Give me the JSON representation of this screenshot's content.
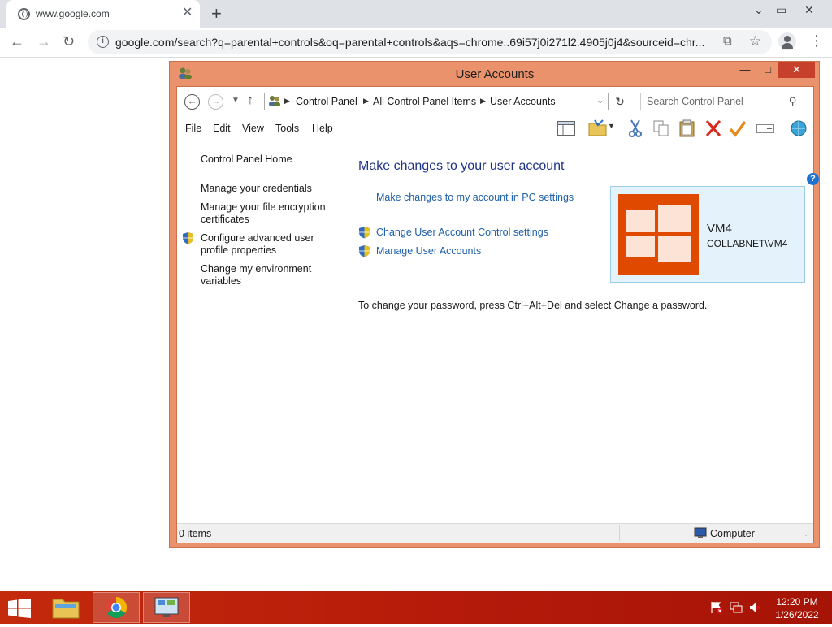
{
  "browser": {
    "tab_title": "www.google.com",
    "tab_close": "✕",
    "new_tab": "+",
    "url": "google.com/search?q=parental+controls&oq=parental+controls&aqs=chrome..69i57j0i271l2.4905j0j4&sourceid=chr...",
    "icons": [
      "globe-icon",
      "back-icon",
      "forward-icon",
      "reload-icon",
      "info-icon",
      "share-icon",
      "star-icon",
      "profile-icon",
      "menu-icon"
    ]
  },
  "window": {
    "title": "User Accounts",
    "address": {
      "crumbs": [
        "Control Panel",
        "All Control Panel Items",
        "User Accounts"
      ],
      "search_placeholder": "Search Control Panel"
    },
    "menu": [
      "File",
      "Edit",
      "View",
      "Tools",
      "Help"
    ],
    "left_pane": {
      "home": "Control Panel Home",
      "manage_credentials": "Manage your credentials",
      "file_encryption": "Manage your file encryption certificates",
      "profile_properties": "Configure advanced user profile properties",
      "environment_variables": "Change my environment variables"
    },
    "main": {
      "title": "Make changes to your user account",
      "pc_settings_link": "Make changes to my account in PC settings",
      "uac_link": "Change User Account Control settings",
      "manage_accounts_link": "Manage User Accounts",
      "password_note": "To change your password, press Ctrl+Alt+Del and select Change a password."
    },
    "account": {
      "name": "VM4",
      "domain": "COLLABNET\\VM4"
    },
    "status": {
      "items": "0 items",
      "zone": "Computer"
    }
  },
  "taskbar": {
    "time": "12:20 PM",
    "date": "1/26/2022"
  },
  "colors": {
    "window_frame": "#e9926c",
    "close_button": "#c7402c",
    "taskbar": "#b51a0a",
    "link": "#1e5fa8",
    "account_tile": "#e04a00"
  }
}
